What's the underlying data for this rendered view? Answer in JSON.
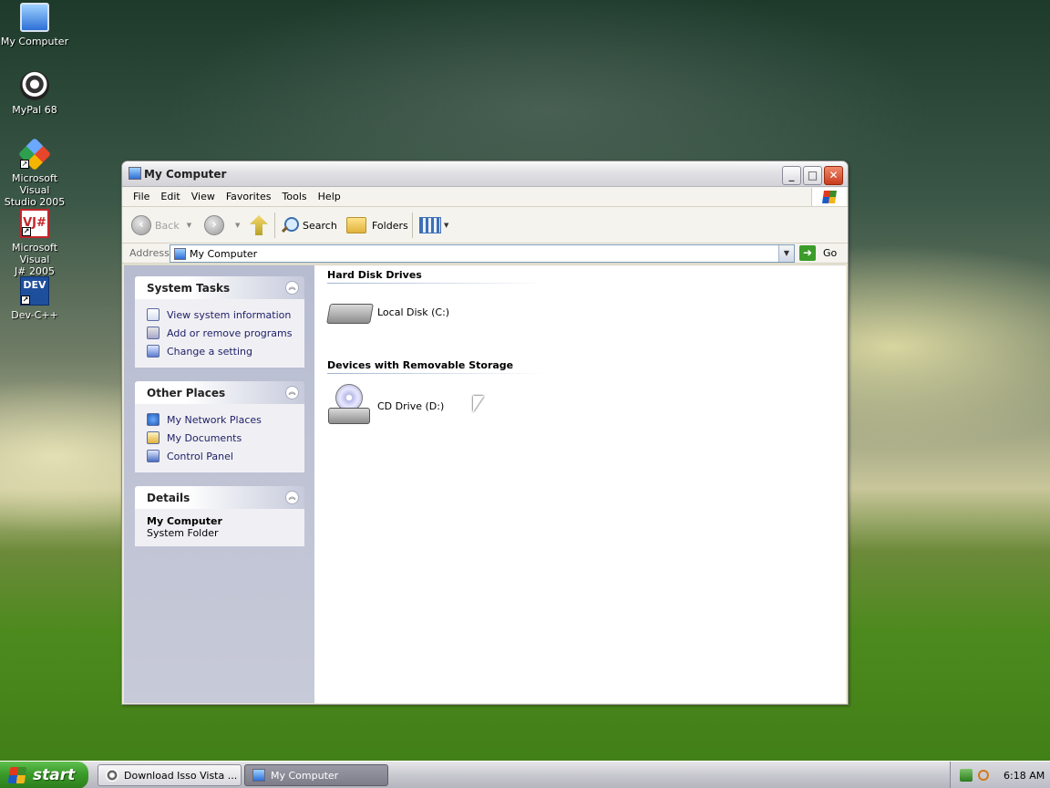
{
  "desktop": {
    "icons": [
      {
        "label": "My Computer"
      },
      {
        "label": "MyPal 68"
      },
      {
        "label_line1": "Microsoft Visual",
        "label_line2": "Studio 2005"
      },
      {
        "label_line1": "Microsoft Visual",
        "label_line2": "J# 2005 Exp..."
      },
      {
        "label": "Dev-C++"
      }
    ],
    "vj_glyph": "VJ#",
    "dev_glyph": "DEV"
  },
  "window": {
    "title": "My Computer",
    "menu": [
      "File",
      "Edit",
      "View",
      "Favorites",
      "Tools",
      "Help"
    ],
    "toolbar": {
      "back": "Back",
      "search": "Search",
      "folders": "Folders"
    },
    "address": {
      "label": "Address",
      "value": "My Computer",
      "go": "Go"
    },
    "sidebar": {
      "system_tasks": {
        "title": "System Tasks",
        "items": [
          "View system information",
          "Add or remove programs",
          "Change a setting"
        ]
      },
      "other_places": {
        "title": "Other Places",
        "items": [
          "My Network Places",
          "My Documents",
          "Control Panel"
        ]
      },
      "details": {
        "title": "Details",
        "name": "My Computer",
        "type": "System Folder"
      }
    },
    "groups": [
      {
        "heading": "Hard Disk Drives",
        "items": [
          "Local Disk (C:)"
        ]
      },
      {
        "heading": "Devices with Removable Storage",
        "items": [
          "CD Drive (D:)"
        ]
      }
    ]
  },
  "taskbar": {
    "start": "start",
    "tasks": [
      "Download Isso Vista ...",
      "My Computer"
    ],
    "clock": "6:18 AM"
  }
}
